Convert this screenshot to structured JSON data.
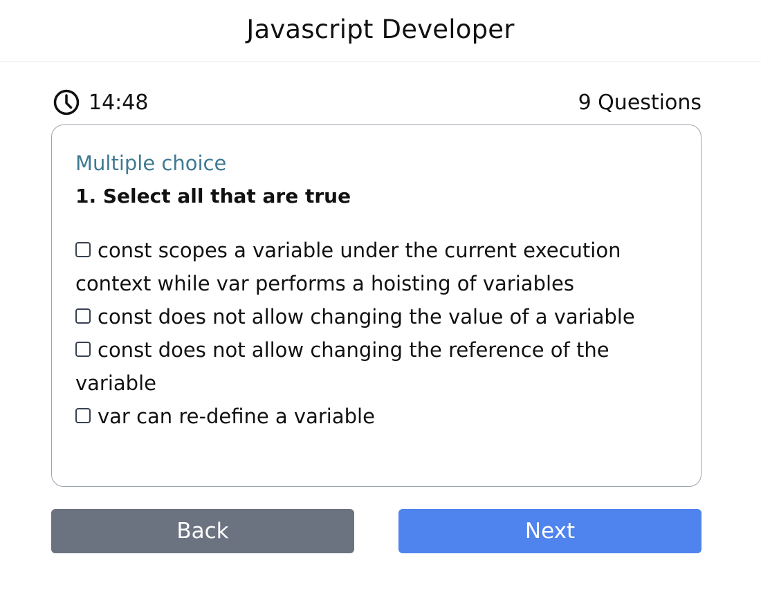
{
  "header": {
    "title": "Javascript Developer"
  },
  "quiz": {
    "timer": "14:48",
    "timer_icon": "clock-icon",
    "question_count": "9 Questions"
  },
  "question": {
    "type": "Multiple choice",
    "text": "1. Select all that are true",
    "options": [
      {
        "label": "const scopes a variable under the current execution context while var performs a hoisting of variables",
        "checked": false
      },
      {
        "label": "const does not allow changing the value of a variable",
        "checked": false
      },
      {
        "label": "const does not allow changing the reference of the variable",
        "checked": false
      },
      {
        "label": "var can re-define a variable",
        "checked": false
      }
    ]
  },
  "nav": {
    "back_label": "Back",
    "next_label": "Next"
  },
  "colors": {
    "accent": "#4f83ed",
    "secondary_button": "#6b7280",
    "question_type": "#3f7a93"
  }
}
